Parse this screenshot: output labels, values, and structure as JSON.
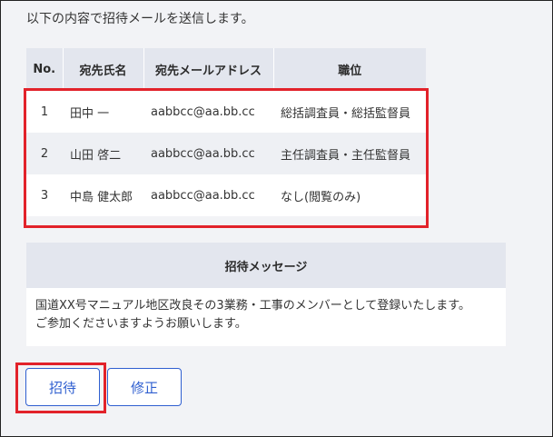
{
  "intro": "以下の内容で招待メールを送信します。",
  "recipients_table": {
    "headers": [
      "No.",
      "宛先氏名",
      "宛先メールアドレス",
      "職位"
    ],
    "rows": [
      {
        "no": "1",
        "name": "田中 一",
        "email": "aabbcc@aa.bb.cc",
        "position": "総括調査員・総括監督員"
      },
      {
        "no": "2",
        "name": "山田 啓二",
        "email": "aabbcc@aa.bb.cc",
        "position": "主任調査員・主任監督員"
      },
      {
        "no": "3",
        "name": "中島 健太郎",
        "email": "aabbcc@aa.bb.cc",
        "position": "なし(閲覧のみ)"
      }
    ]
  },
  "invite_message": {
    "title": "招待メッセージ",
    "lines": [
      "国道XX号マニュアル地区改良その3業務・工事のメンバーとして登録いたします。",
      "ご参加くださいますようお願いします。"
    ]
  },
  "buttons": {
    "invite": "招待",
    "edit": "修正"
  },
  "colors": {
    "background": "#f2f3f6",
    "header_bg": "#e3e6ee",
    "accent": "#2f5fd0",
    "highlight": "#e2222a"
  }
}
